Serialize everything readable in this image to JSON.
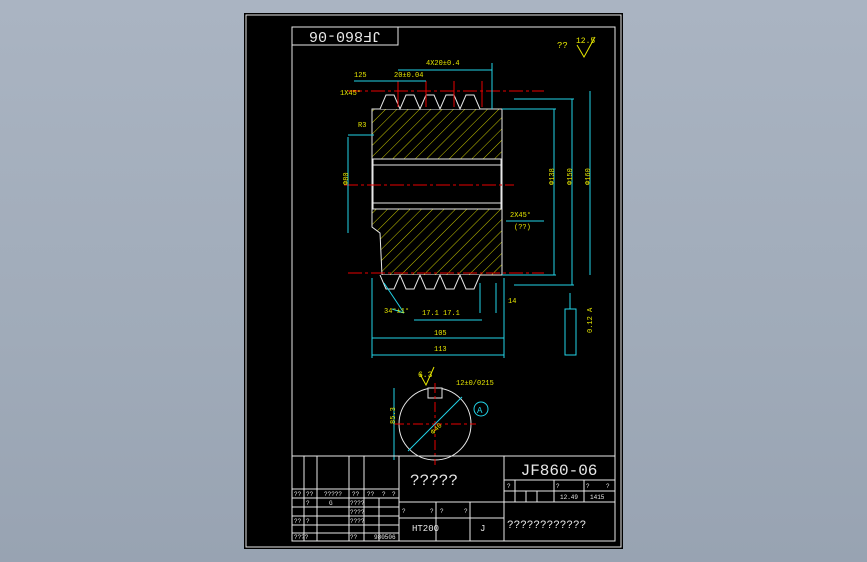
{
  "drawing": {
    "stamp_code": "JF860-06",
    "surface_finish": {
      "prefix": "??",
      "value": "12.5"
    }
  },
  "dimensions": {
    "pitch_total": "4X20±0.4",
    "pitch": "20±0.04",
    "left_offset": "125",
    "chamfer_left": "1X45°",
    "radius": "R3",
    "bore": "Φ80",
    "root_dia": "Φ138",
    "od1": "Φ150",
    "od2": "Φ160",
    "chamfer_right": "2X45°",
    "chamfer_note": "(??)",
    "thread_angle": "34°±1°",
    "tooth_depth": "17.1 17.1",
    "width_inner": "105",
    "width_outer": "113",
    "root_width": "14",
    "runout": "0.12 A",
    "keyway_roughness": "6.3",
    "keyway_width": "12±0/0215",
    "keyway_depth": "85.3",
    "keyway_dia": "Φ40",
    "datum": "A"
  },
  "title_block": {
    "part_name": "?????",
    "drawing_no": "JF860-06",
    "material": "HT200",
    "scale_marks": "J",
    "company": "????????????",
    "r1": [
      "?",
      "?",
      "?",
      "?"
    ],
    "r2": [
      "12.49",
      "1415"
    ],
    "left_row1": [
      "??",
      "??",
      "?????",
      "??",
      "??",
      "?",
      "?"
    ],
    "left_row2": [
      "?",
      "G",
      "????"
    ],
    "left_row3": [
      "????",
      "????"
    ],
    "left_row4": [
      "??",
      "?"
    ],
    "left_row5": [
      "????",
      "??",
      "980506"
    ],
    "mid_q": [
      "?",
      "?",
      "?",
      "?"
    ]
  }
}
